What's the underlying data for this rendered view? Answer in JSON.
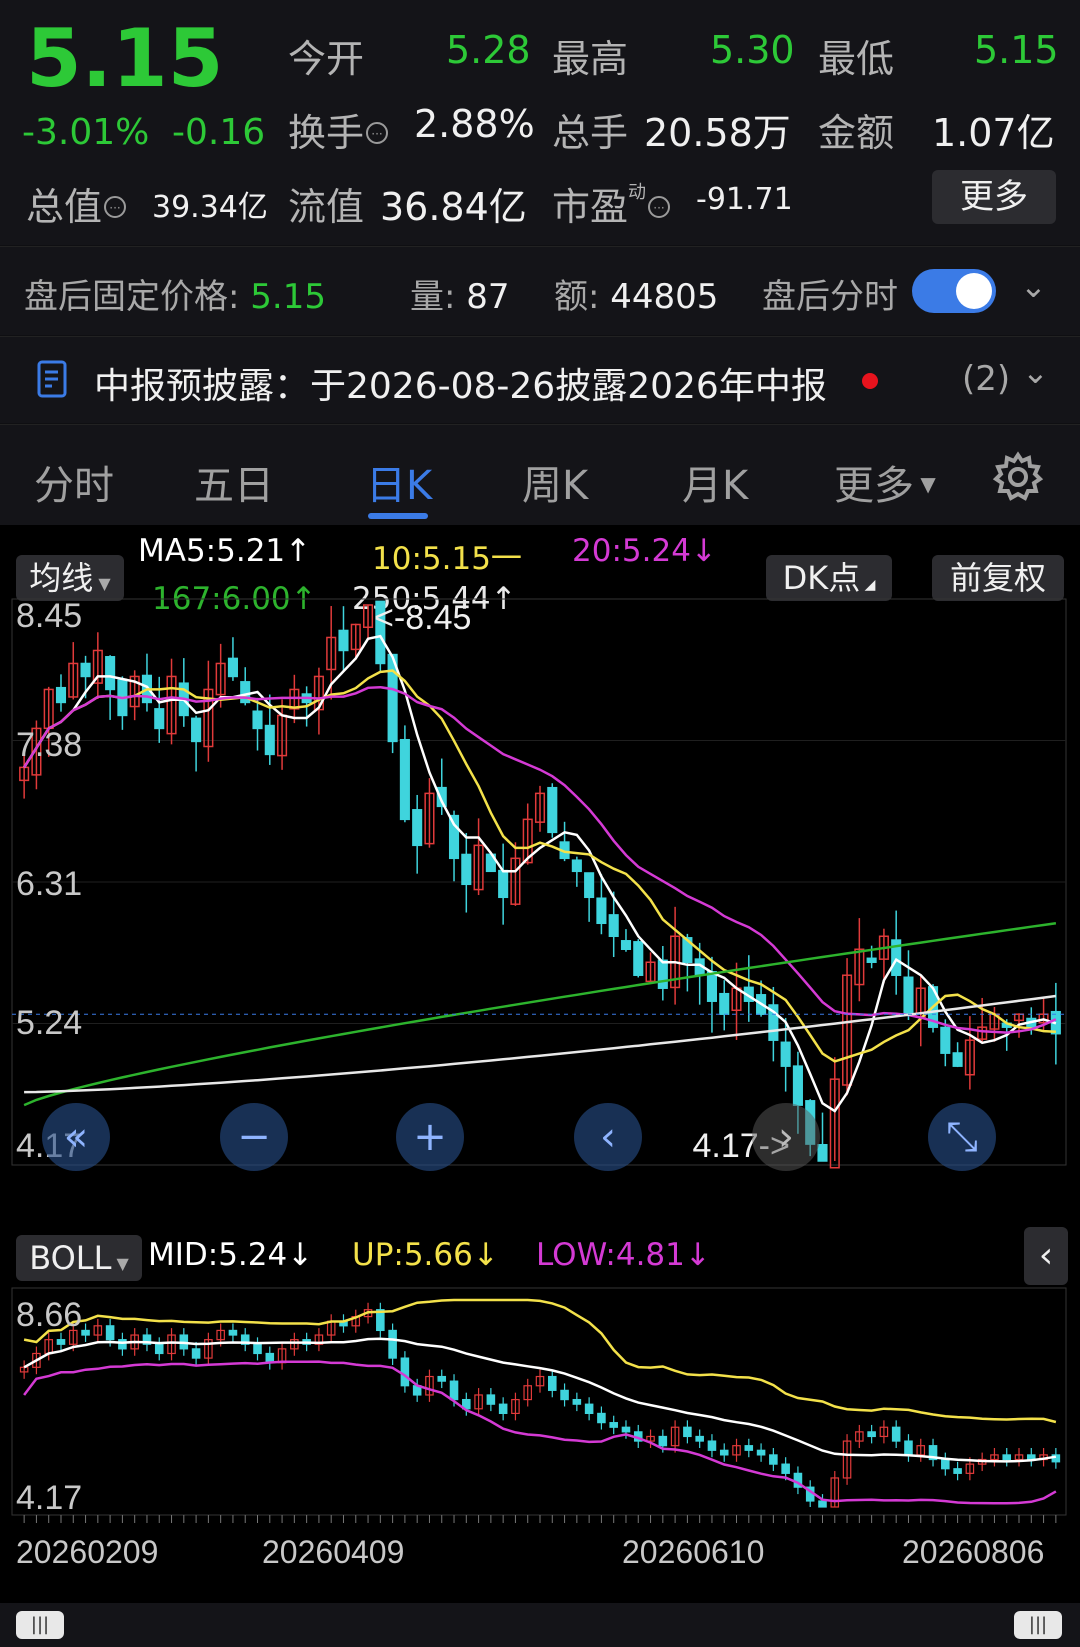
{
  "quote": {
    "price": "5.15",
    "change_pct": "-3.01%",
    "change_abs": "-0.16",
    "open_label": "今开",
    "open": "5.28",
    "high_label": "最高",
    "high": "5.30",
    "low_label": "最低",
    "low": "5.15",
    "turnover_label": "换手",
    "turnover": "2.88%",
    "volume_label": "总手",
    "volume": "20.58万",
    "amount_label": "金额",
    "amount": "1.07亿",
    "total_cap_label": "总值",
    "total_cap": "39.34亿",
    "float_cap_label": "流值",
    "float_cap": "36.84亿",
    "pe_label": "市盈",
    "pe_sup": "动",
    "pe": "-91.71",
    "more_button": "更多",
    "colors": {
      "down": "#2dc937",
      "up": "#e03a3a"
    }
  },
  "after_hours": {
    "fixed_price_label": "盘后固定价格:",
    "fixed_price": "5.15",
    "vol_label": "量:",
    "vol": "87",
    "amt_label": "额:",
    "amt": "44805",
    "timeshare_label": "盘后分时",
    "toggle_on": true
  },
  "notice": {
    "text": "中报预披露：于2026-08-26披露2026年中报",
    "count": "(2)"
  },
  "tabs": [
    {
      "label": "分时"
    },
    {
      "label": "五日"
    },
    {
      "label": "日K",
      "active": true
    },
    {
      "label": "周K"
    },
    {
      "label": "月K"
    },
    {
      "label": "更多"
    }
  ],
  "indicators": {
    "ma_button": "均线",
    "ma5": "MA5:5.21↑",
    "ma10": "10:5.15一",
    "ma20": "20:5.24↓",
    "ma167": "167:6.00↑",
    "ma250": "250:5.44↑",
    "dk_button": "DK点",
    "adj_button": "前复权",
    "boll_button": "BOLL",
    "boll_mid": "MID:5.24↓",
    "boll_up": "UP:5.66↓",
    "boll_low": "LOW:4.81↓",
    "colors": {
      "ma5": "#ffffff",
      "ma10": "#f3e14a",
      "ma20": "#d43ad4",
      "ma167": "#2db32d",
      "ma250": "#e8e8e8"
    }
  },
  "main_chart": {
    "y_labels": [
      "8.45",
      "7.38",
      "6.31",
      "5.24",
      "4.17"
    ],
    "max_annotation": "<-8.45",
    "min_annotation": "4.17->",
    "x_labels": [
      "20260209",
      "20260409",
      "20260610",
      "20260806"
    ]
  },
  "boll_chart": {
    "y_labels": [
      "8.66",
      "4.17"
    ]
  },
  "chart_data": {
    "type": "candlestick",
    "ylim": [
      4.17,
      8.45
    ],
    "high": 8.45,
    "low": 4.17,
    "last_close": 5.15,
    "ma_values": {
      "MA5": 5.21,
      "MA10": 5.15,
      "MA20": 5.24,
      "MA167": 6.0,
      "MA250": 5.44
    },
    "boll_values": {
      "MID": 5.24,
      "UP": 5.66,
      "LOW": 4.81
    },
    "x_ticks": [
      "20260209",
      "20260409",
      "20260610",
      "20260806"
    ],
    "close_series": [
      7.2,
      7.5,
      7.8,
      7.7,
      8.0,
      7.9,
      8.1,
      7.8,
      7.6,
      7.9,
      7.7,
      7.5,
      7.9,
      7.6,
      7.4,
      7.8,
      8.0,
      7.9,
      7.7,
      7.5,
      7.3,
      7.6,
      7.8,
      7.7,
      7.9,
      8.2,
      8.1,
      8.3,
      8.45,
      8.0,
      7.4,
      6.8,
      6.6,
      7.0,
      6.9,
      6.5,
      6.3,
      6.6,
      6.4,
      6.2,
      6.5,
      6.8,
      7.0,
      6.7,
      6.5,
      6.4,
      6.2,
      6.0,
      5.9,
      5.8,
      5.6,
      5.7,
      5.5,
      5.9,
      5.7,
      5.6,
      5.4,
      5.3,
      5.5,
      5.4,
      5.3,
      5.1,
      4.9,
      4.6,
      4.3,
      4.17,
      4.8,
      5.6,
      5.8,
      5.7,
      5.9,
      5.6,
      5.3,
      5.5,
      5.2,
      5.0,
      4.9,
      5.1,
      5.2,
      5.3,
      5.2,
      5.3,
      5.2,
      5.3,
      5.15
    ]
  }
}
